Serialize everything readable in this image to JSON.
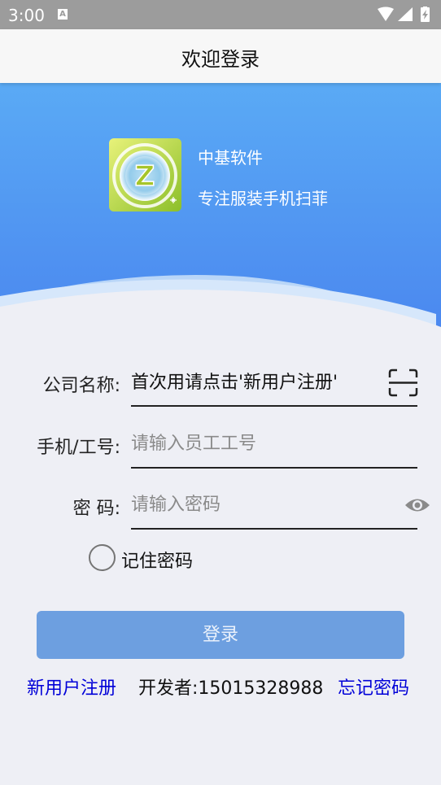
{
  "status_bar": {
    "time": "3:00",
    "notification_letter": "A",
    "icons": [
      "wifi-icon",
      "signal-icon",
      "battery-icon"
    ]
  },
  "header": {
    "title": "欢迎登录"
  },
  "brand": {
    "logo_letter": "Z",
    "name": "中基软件",
    "slogan": "专注服装手机扫菲"
  },
  "form": {
    "company": {
      "label": "公司名称:",
      "value": "首次用请点击'新用户注册'"
    },
    "phone": {
      "label": "手机/工号:",
      "placeholder": "请输入员工工号"
    },
    "password": {
      "label": "密 码:",
      "placeholder": "请输入密码"
    },
    "remember_label": "记住密码"
  },
  "login_button": "登录",
  "footer": {
    "register_link": "新用户注册",
    "developer": "开发者:15015328988",
    "forgot_link": "忘记密码"
  },
  "colors": {
    "banner_top": "#5aaaf5",
    "banner_bottom": "#4a86ef",
    "login_button": "#6d9fe0",
    "link": "#0000d8"
  }
}
